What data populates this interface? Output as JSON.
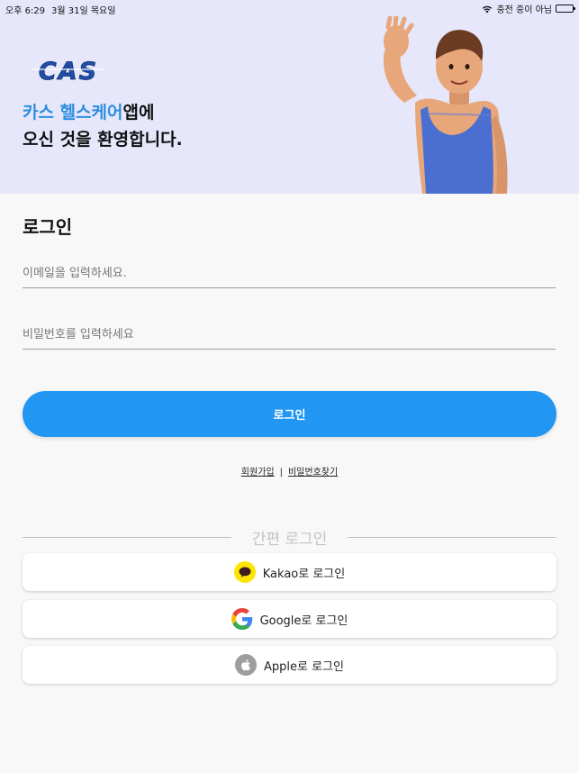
{
  "status_bar": {
    "time": "오후 6:29",
    "date": "3월 31일 목요일",
    "battery_text": "충전 중이 아님"
  },
  "hero": {
    "logo_text": "CAS",
    "welcome_accent": "카스 헬스케어",
    "welcome_rest": "앱에",
    "welcome_line2": "오신 것을 환영합니다."
  },
  "login": {
    "title": "로그인",
    "email_placeholder": "이메일을 입력하세요.",
    "password_placeholder": "비밀번호를 입력하세요",
    "button_label": "로그인"
  },
  "links": {
    "signup": "회원가입",
    "separator": "|",
    "find_password": "비밀번호찾기"
  },
  "easy_login": {
    "label": "간편 로그인",
    "kakao": "Kakao로 로그인",
    "google": "Google로 로그인",
    "apple": "Apple로 로그인"
  },
  "colors": {
    "accent": "#2196f3",
    "hero_background": "#e6e7fb",
    "kakao_yellow": "#fee500"
  },
  "icons": [
    "wifi-icon",
    "battery-icon",
    "kakao-icon",
    "google-icon",
    "apple-icon"
  ]
}
